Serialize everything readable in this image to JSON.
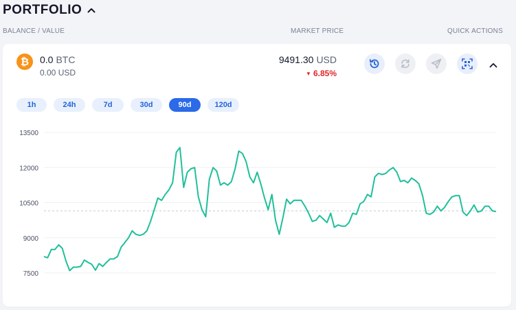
{
  "header": {
    "title": "PORTFOLIO"
  },
  "columns": {
    "balance": "BALANCE / VALUE",
    "market_price": "MARKET PRICE",
    "quick_actions": "QUICK ACTIONS"
  },
  "asset": {
    "icon": "bitcoin-icon",
    "icon_glyph": "₿",
    "icon_color": "#f7931a",
    "balance": "0.0",
    "symbol": "BTC",
    "balance_usd": "0.00 USD",
    "price": "9491.30",
    "price_unit": "USD",
    "change": "6.85%",
    "change_color": "#e0262a"
  },
  "quick_actions": [
    {
      "name": "history",
      "icon": "history-icon",
      "enabled": true
    },
    {
      "name": "exchange",
      "icon": "exchange-icon",
      "enabled": false
    },
    {
      "name": "send",
      "icon": "send-icon",
      "enabled": false
    },
    {
      "name": "receive",
      "icon": "qr-code-icon",
      "enabled": true
    }
  ],
  "timeframes": [
    {
      "label": "1h",
      "active": false
    },
    {
      "label": "24h",
      "active": false
    },
    {
      "label": "7d",
      "active": false
    },
    {
      "label": "30d",
      "active": false
    },
    {
      "label": "90d",
      "active": true
    },
    {
      "label": "120d",
      "active": false
    }
  ],
  "chart_data": {
    "type": "line",
    "ylim": [
      7500,
      13500
    ],
    "yticks": [
      7500,
      9000,
      10500,
      12000,
      13500
    ],
    "ytick_labels": [
      "7500",
      "9000",
      "10500",
      "12000",
      "13500"
    ],
    "reference_line": 10150,
    "grid": true,
    "line_color": "#1fbf9a",
    "series": [
      {
        "values": [
          8200,
          8150,
          8500,
          8500,
          8700,
          8550,
          8000,
          7600,
          7750,
          7750,
          7780,
          8050,
          7950,
          7870,
          7620,
          7900,
          7780,
          7950,
          8100,
          8100,
          8200,
          8600,
          8800,
          9000,
          9300,
          9150,
          9100,
          9150,
          9300,
          9700,
          10200,
          10700,
          10600,
          10850,
          11050,
          11350,
          12650,
          12850,
          11150,
          11800,
          11950,
          12000,
          10750,
          10200,
          9900,
          11500,
          12000,
          11850,
          11250,
          11350,
          11250,
          11400,
          11950,
          12700,
          12600,
          12250,
          11600,
          11350,
          11800,
          11300,
          10700,
          10200,
          10850,
          9750,
          9150,
          9850,
          10650,
          10450,
          10600,
          10600,
          10600,
          10350,
          10050,
          9700,
          9750,
          9950,
          9800,
          9650,
          10050,
          9450,
          9550,
          9500,
          9500,
          9650,
          10050,
          10000,
          10450,
          10550,
          10850,
          10750,
          11600,
          11750,
          11700,
          11750,
          11900,
          12000,
          11800,
          11400,
          11450,
          11350,
          11550,
          11450,
          11300,
          10800,
          10050,
          10000,
          10100,
          10350,
          10150,
          10300,
          10550,
          10750,
          10800,
          10800,
          10100,
          9950,
          10150,
          10400,
          10100,
          10150,
          10350,
          10350,
          10150,
          10120
        ]
      }
    ]
  }
}
